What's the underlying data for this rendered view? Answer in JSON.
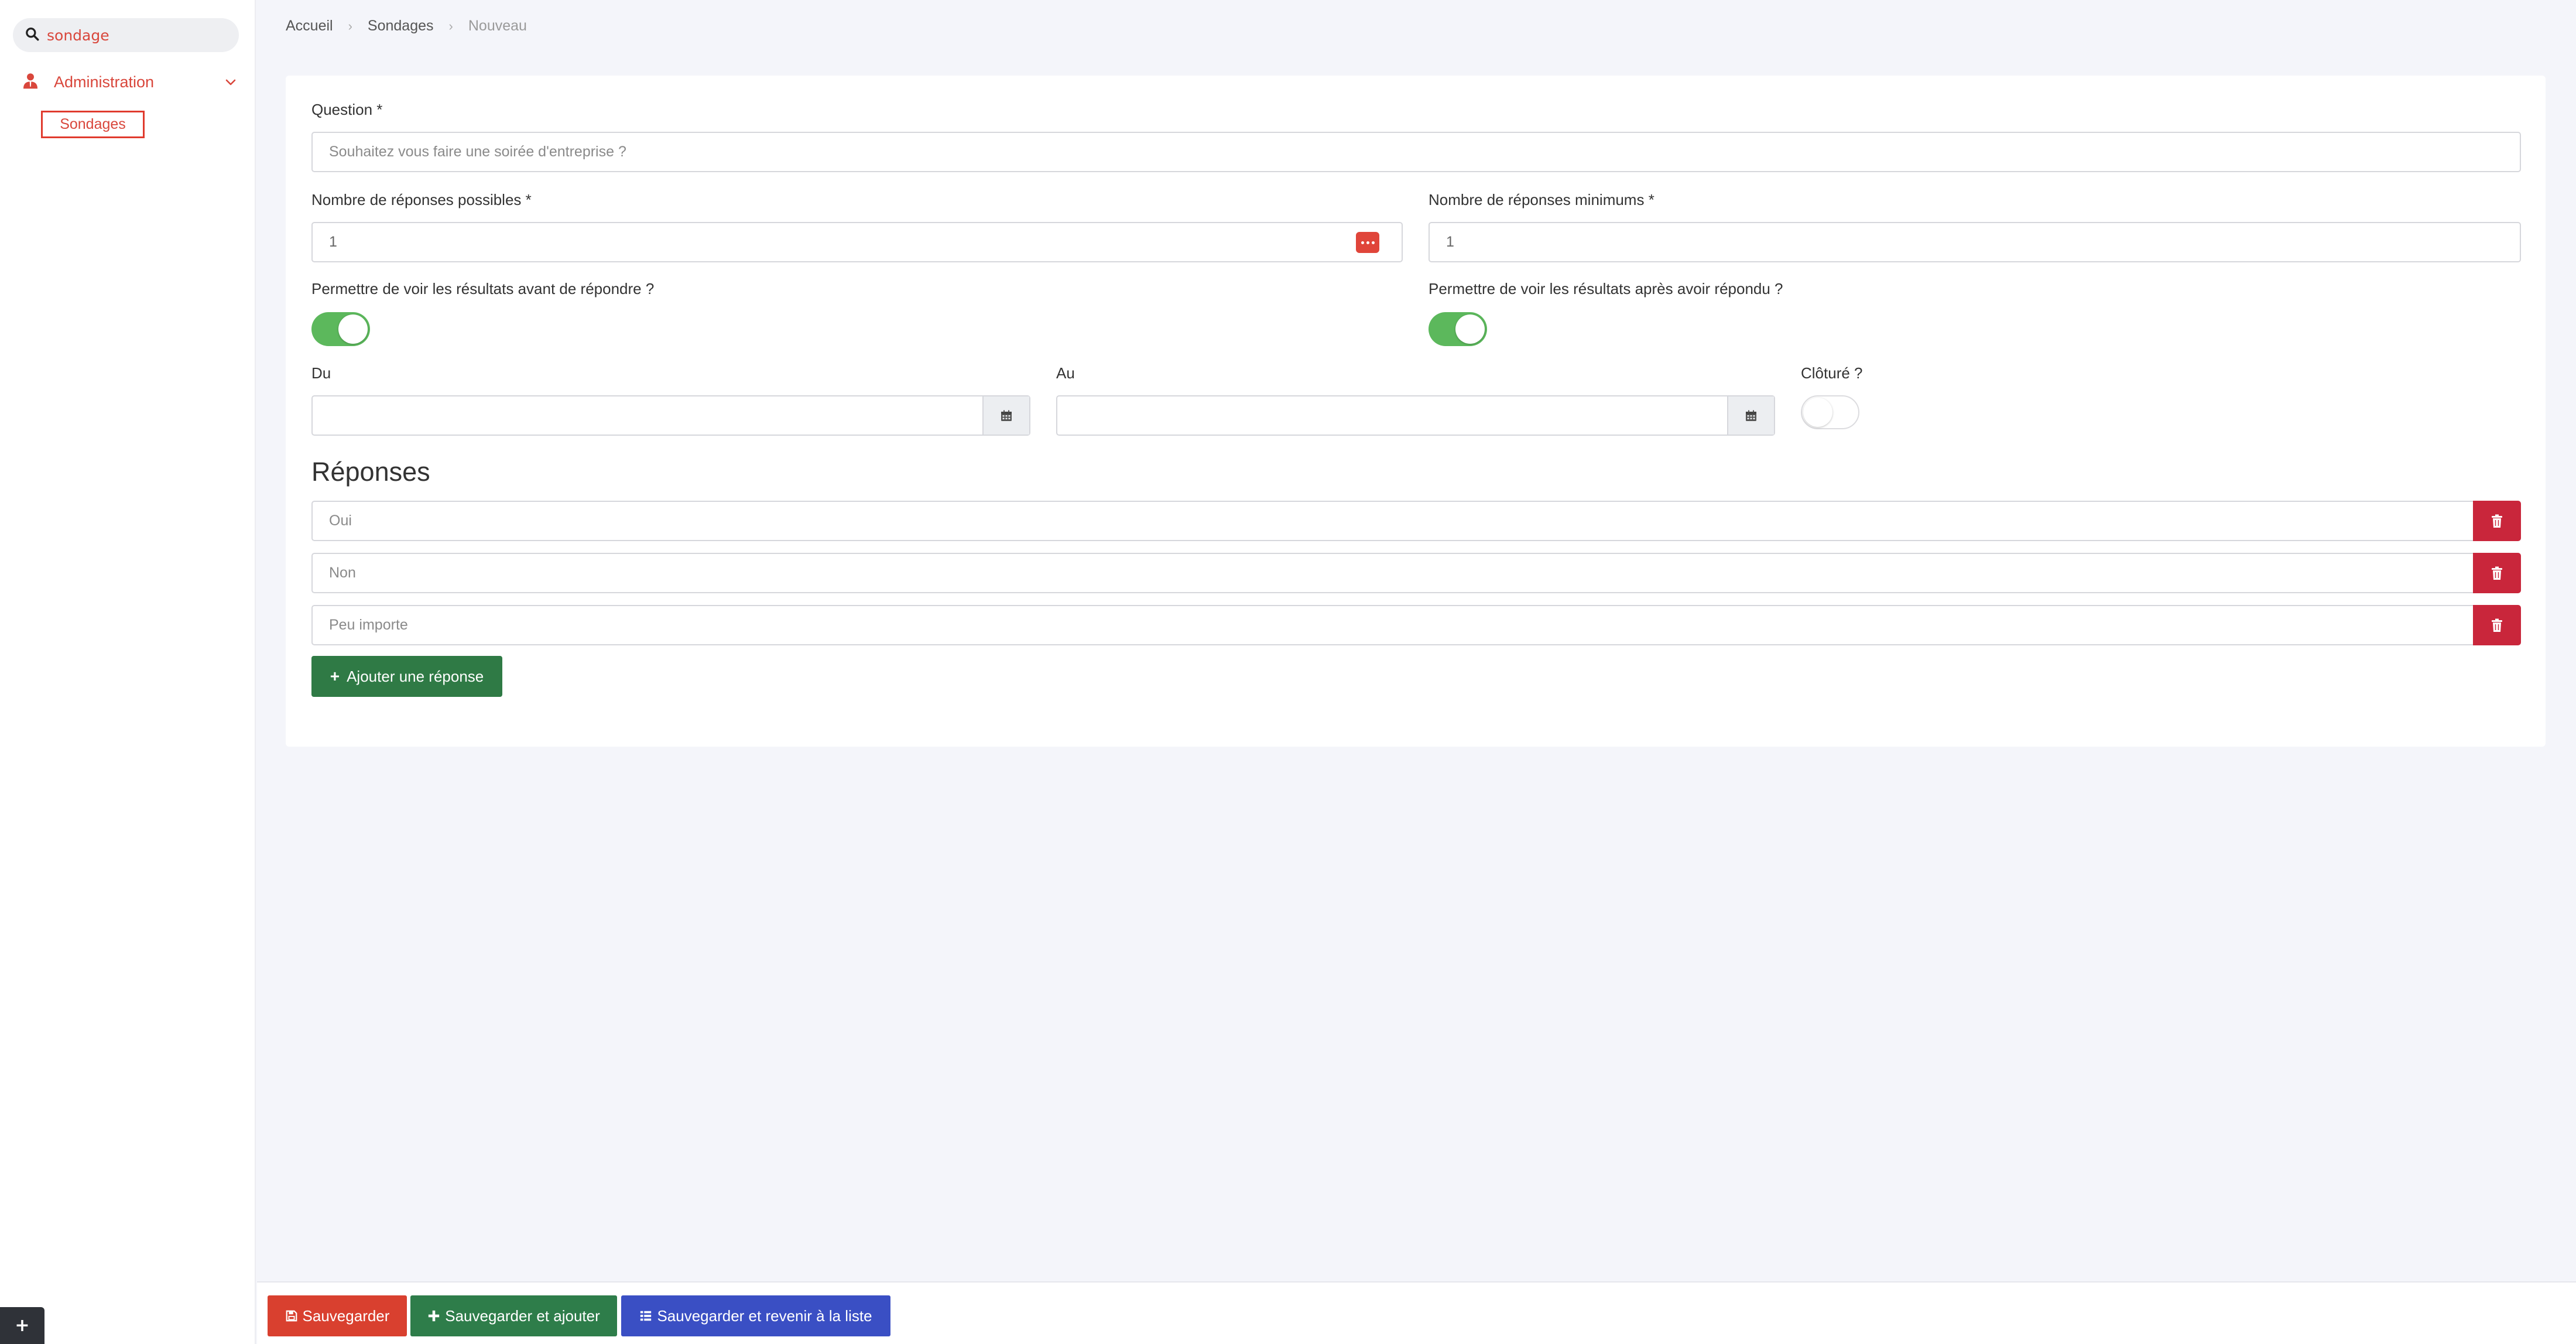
{
  "sidebar": {
    "search_value": "sondage",
    "admin_label": "Administration",
    "sub_item_label": "Sondages",
    "corner_button": "+"
  },
  "breadcrumb": {
    "home": "Accueil",
    "section": "Sondages",
    "current": "Nouveau"
  },
  "form": {
    "question_label": "Question *",
    "question_placeholder": "Souhaitez vous faire une soirée d'entreprise ?",
    "possible_label": "Nombre de réponses possibles *",
    "possible_value": "1",
    "minimum_label": "Nombre de réponses minimums *",
    "minimum_value": "1",
    "before_label": "Permettre de voir les résultats avant de répondre ?",
    "before_on": true,
    "after_label": "Permettre de voir les résultats après avoir répondu ?",
    "after_on": true,
    "from_label": "Du",
    "to_label": "Au",
    "closed_label": "Clôturé ?",
    "closed_on": false
  },
  "answers": {
    "title": "Réponses",
    "items": [
      {
        "placeholder": "Oui"
      },
      {
        "placeholder": "Non"
      },
      {
        "placeholder": "Peu importe"
      }
    ],
    "add_label": "Ajouter une réponse"
  },
  "footer": {
    "save_label": "Sauvegarder",
    "save_add_label": "Sauvegarder et ajouter",
    "save_back_label": "Sauvegarder et revenir à la liste"
  },
  "colors": {
    "accent": "#d9473c",
    "toggle_on": "#5cb85c",
    "delete": "#c9263b",
    "add": "#2f7a45",
    "save": "#d9402f",
    "save_add": "#2e7d4a",
    "save_back": "#3a4fc4"
  }
}
